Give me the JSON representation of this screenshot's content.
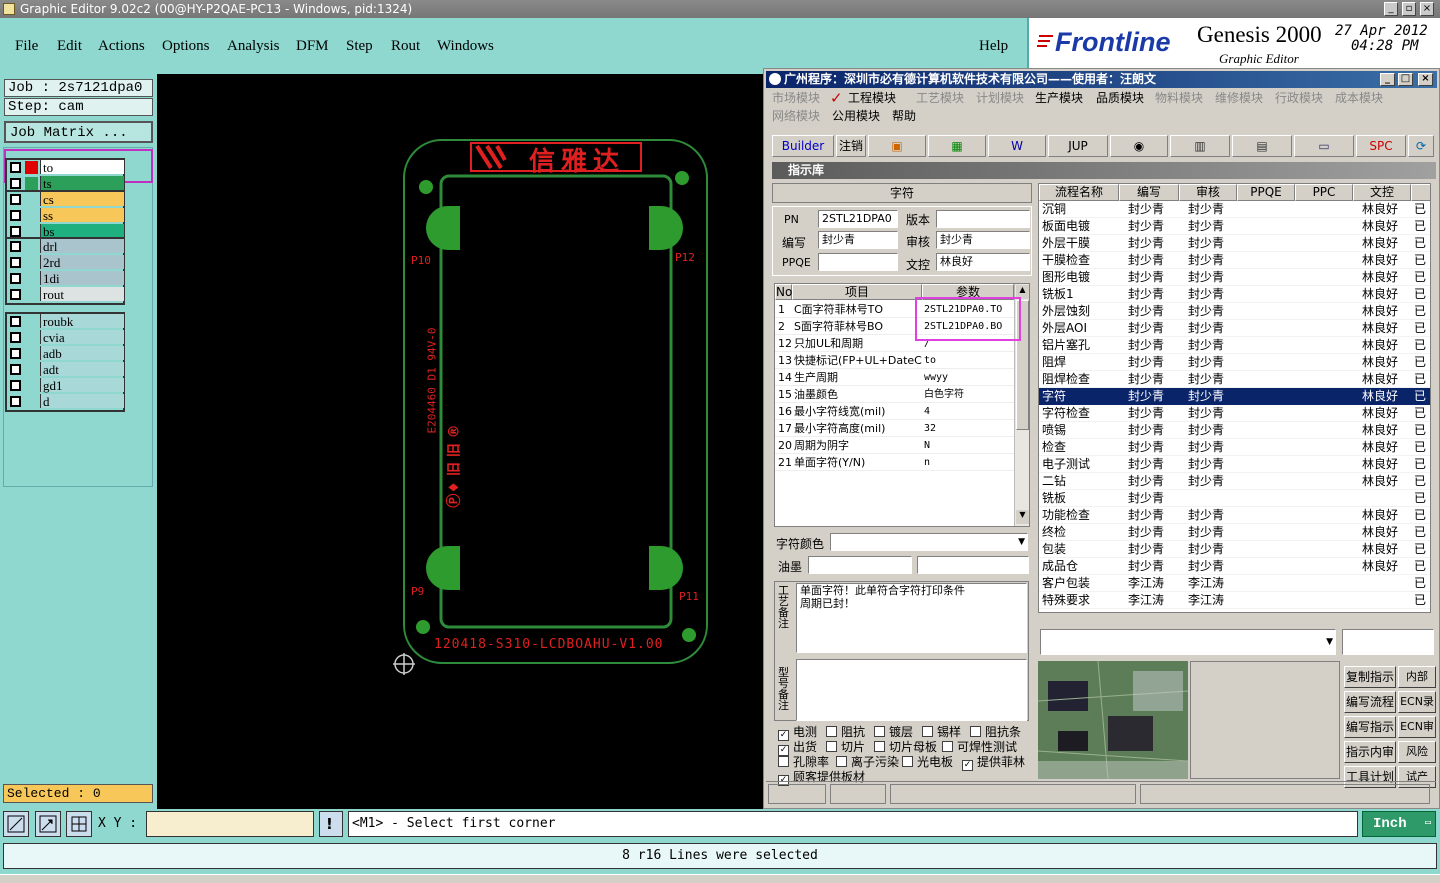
{
  "window": {
    "title": "Graphic Editor 9.02c2 (00@HY-P2QAE-PC13 - Windows, pid:1324)"
  },
  "menu": [
    "File",
    "Edit",
    "Actions",
    "Options",
    "Analysis",
    "DFM",
    "Step",
    "Rout",
    "Windows"
  ],
  "help": "Help",
  "brand": {
    "logo": "Frontline",
    "product": "Genesis 2000",
    "subtitle": "Graphic Editor",
    "date": "27 Apr 2012",
    "time": "04:28 PM"
  },
  "left": {
    "job": "Job : 2s7121dpa0",
    "step": "Step: cam",
    "job_matrix": "Job Matrix ...",
    "groups": [
      [
        {
          "name": "to",
          "color": "#ffffff",
          "swatch": "#e00000"
        },
        {
          "name": "ts",
          "color": "#2ca05a",
          "swatch": "#2ca05a"
        }
      ],
      [
        {
          "name": "cs",
          "color": "#f7c75a",
          "swatch": "#8ed8d0"
        },
        {
          "name": "ss",
          "color": "#f7c75a",
          "swatch": "#8ed8d0"
        },
        {
          "name": "bs",
          "color": "#1fb080",
          "swatch": "#8ed8d0"
        }
      ],
      [
        {
          "name": "drl",
          "color": "#a9c4cc",
          "swatch": "#8ed8d0"
        },
        {
          "name": "2rd",
          "color": "#a9c4cc",
          "swatch": "#8ed8d0"
        },
        {
          "name": "1di",
          "color": "#a9c4cc",
          "swatch": "#8ed8d0"
        },
        {
          "name": "rout",
          "color": "#dde3e3",
          "swatch": "#8ed8d0"
        }
      ],
      [
        {
          "name": "roubk",
          "color": "#a9d8d8",
          "swatch": "#8ed8d0"
        },
        {
          "name": "cvia",
          "color": "#a9d8d8",
          "swatch": "#8ed8d0"
        },
        {
          "name": "adb",
          "color": "#a9d8d8",
          "swatch": "#8ed8d0"
        },
        {
          "name": "adt",
          "color": "#a9d8d8",
          "swatch": "#8ed8d0"
        },
        {
          "name": "gd1",
          "color": "#a9d8d8",
          "swatch": "#8ed8d0"
        },
        {
          "name": "d",
          "color": "#a9d8d8",
          "swatch": "#8ed8d0"
        }
      ]
    ],
    "selected": "Selected : 0"
  },
  "board": {
    "header_text": "信雅达",
    "bottom_text": "120418-S310-LCDBOAHU-V1.00",
    "side_text": "E204460 D1 94V-0",
    "pads": [
      "P10",
      "P12",
      "P9",
      "P11"
    ]
  },
  "dialog": {
    "title": "广州程序：深圳市必有德计算机软件技术有限公司——使用者：汪朗文",
    "modules_row1": [
      "市场模块",
      "工程模块",
      "工艺模块",
      "计划模块",
      "生产模块",
      "品质模块",
      "物料模块",
      "维修模块",
      "行政模块",
      "成本模块"
    ],
    "modules_row2": [
      "网络模块",
      "公用模块",
      "帮助"
    ],
    "active_modules": [
      "工程模块",
      "生产模块",
      "品质模块",
      "公用模块",
      "帮助"
    ],
    "toolbar": [
      "Builder",
      "注销",
      "",
      "",
      "",
      "JUP",
      "",
      "",
      "",
      "",
      "SPC",
      ""
    ],
    "section": "指示库",
    "form_title": "字符",
    "form": {
      "pn_label": "PN",
      "pn": "2STL21DPA0",
      "ver_label": "版本",
      "ver": "",
      "writer_label": "编写",
      "writer": "封少青",
      "review_label": "审核",
      "review": "封少青",
      "ppqe_label": "PPQE",
      "ppqe": "",
      "doc_label": "文控",
      "doc": "林良好"
    },
    "param_headers": [
      "No",
      "项目",
      "参数"
    ],
    "params": [
      [
        "1",
        "C面字符菲林号TO",
        "2STL21DPA0.TO"
      ],
      [
        "2",
        "S面字符菲林号BO",
        "2STL21DPA0.BO"
      ],
      [
        "12",
        "只加UL和周期",
        "/"
      ],
      [
        "13",
        "快捷标记(FP+UL+DateCo",
        "to"
      ],
      [
        "14",
        "生产周期",
        "wwyy"
      ],
      [
        "15",
        "油墨颜色",
        "白色字符"
      ],
      [
        "16",
        "最小字符线宽(mil)",
        "4"
      ],
      [
        "17",
        "最小字符高度(mil)",
        "32"
      ],
      [
        "20",
        "周期为阴字",
        "N"
      ],
      [
        "21",
        "单面字符(Y/N)",
        "n"
      ]
    ],
    "char_color_label": "字符颜色",
    "ink_label": "油墨",
    "note1_label": "工艺备注",
    "note1": "单面字符！此单符合字符打印条件\n周期已封！",
    "note2_label": "型号备注",
    "checks": [
      [
        {
          "l": "电测",
          "c": true
        },
        {
          "l": "阻抗",
          "c": false
        },
        {
          "l": "镀层",
          "c": false
        },
        {
          "l": "锡样",
          "c": false
        },
        {
          "l": "阻抗条",
          "c": false
        }
      ],
      [
        {
          "l": "出货",
          "c": true
        },
        {
          "l": "切片",
          "c": false
        },
        {
          "l": "切片母板",
          "c": false
        },
        {
          "l": "可焊性测试",
          "c": false
        }
      ],
      [
        {
          "l": "孔隙率",
          "c": false
        },
        {
          "l": "离子污染",
          "c": false
        },
        {
          "l": "光电板",
          "c": false
        },
        {
          "l": "提供菲林",
          "c": true
        }
      ],
      [
        {
          "l": "顾客提供板材",
          "c": true
        }
      ]
    ],
    "flow_headers": [
      "流程名称",
      "编写",
      "审核",
      "PPQE",
      "PPC",
      "文控",
      ""
    ],
    "flow": [
      [
        "沉铜",
        "封少青",
        "封少青",
        "",
        "",
        "林良好",
        "已"
      ],
      [
        "板面电镀",
        "封少青",
        "封少青",
        "",
        "",
        "林良好",
        "已"
      ],
      [
        "外层干膜",
        "封少青",
        "封少青",
        "",
        "",
        "林良好",
        "已"
      ],
      [
        "干膜检查",
        "封少青",
        "封少青",
        "",
        "",
        "林良好",
        "已"
      ],
      [
        "图形电镀",
        "封少青",
        "封少青",
        "",
        "",
        "林良好",
        "已"
      ],
      [
        "铣板1",
        "封少青",
        "封少青",
        "",
        "",
        "林良好",
        "已"
      ],
      [
        "外层蚀刻",
        "封少青",
        "封少青",
        "",
        "",
        "林良好",
        "已"
      ],
      [
        "外层AOI",
        "封少青",
        "封少青",
        "",
        "",
        "林良好",
        "已"
      ],
      [
        "铝片塞孔",
        "封少青",
        "封少青",
        "",
        "",
        "林良好",
        "已"
      ],
      [
        "阻焊",
        "封少青",
        "封少青",
        "",
        "",
        "林良好",
        "已"
      ],
      [
        "阻焊检查",
        "封少青",
        "封少青",
        "",
        "",
        "林良好",
        "已"
      ],
      [
        "字符",
        "封少青",
        "封少青",
        "",
        "",
        "林良好",
        "已"
      ],
      [
        "字符检查",
        "封少青",
        "封少青",
        "",
        "",
        "林良好",
        "已"
      ],
      [
        "喷锡",
        "封少青",
        "封少青",
        "",
        "",
        "林良好",
        "已"
      ],
      [
        "检查",
        "封少青",
        "封少青",
        "",
        "",
        "林良好",
        "已"
      ],
      [
        "电子测试",
        "封少青",
        "封少青",
        "",
        "",
        "林良好",
        "已"
      ],
      [
        "二钻",
        "封少青",
        "封少青",
        "",
        "",
        "林良好",
        "已"
      ],
      [
        "铣板",
        "封少青",
        "",
        "",
        "",
        "",
        "已"
      ],
      [
        "功能检查",
        "封少青",
        "封少青",
        "",
        "",
        "林良好",
        "已"
      ],
      [
        "终检",
        "封少青",
        "封少青",
        "",
        "",
        "林良好",
        "已"
      ],
      [
        "包装",
        "封少青",
        "封少青",
        "",
        "",
        "林良好",
        "已"
      ],
      [
        "成品仓",
        "封少青",
        "封少青",
        "",
        "",
        "林良好",
        "已"
      ],
      [
        "客户包装",
        "李江涛",
        "李江涛",
        "",
        "",
        "",
        "已"
      ],
      [
        "特殊要求",
        "李江涛",
        "李江涛",
        "",
        "",
        "",
        "已"
      ]
    ],
    "selected_flow_index": 11,
    "right_buttons": [
      [
        "复制指示",
        "内部"
      ],
      [
        "编写流程",
        "ECN录"
      ],
      [
        "编写指示",
        "ECN审"
      ],
      [
        "指示内审",
        "风险"
      ],
      [
        "工具计划",
        "试产"
      ]
    ]
  },
  "bottom": {
    "xy_label": "X Y :",
    "xy_value": "",
    "prompt": "<M1> - Select first corner",
    "units": "Inch",
    "status": "8 r16 Lines were selected"
  }
}
